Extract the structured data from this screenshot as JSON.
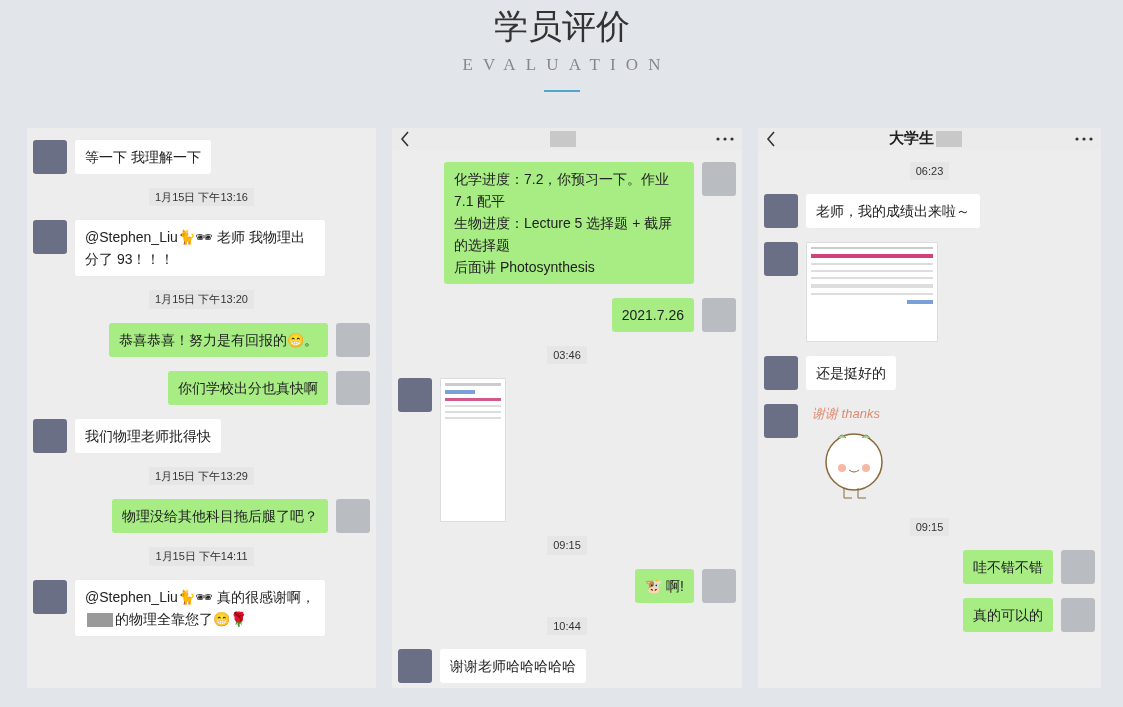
{
  "heading": {
    "title": "学员评价",
    "subtitle": "EVALUATION"
  },
  "panels": [
    {
      "header": false,
      "messages": [
        {
          "kind": "text",
          "outgoing": false,
          "lines": [
            [
              "等一下 我理解一下"
            ]
          ]
        },
        {
          "kind": "time",
          "text": "1月15日 下午13:16"
        },
        {
          "kind": "text",
          "outgoing": false,
          "lines": [
            [
              "@Stephen_Liu🐈🕶 老师 我物理出分了 93！！！"
            ]
          ]
        },
        {
          "kind": "time",
          "text": "1月15日 下午13:20"
        },
        {
          "kind": "text",
          "outgoing": true,
          "lines": [
            [
              "恭喜恭喜！努力是有回报的😁。"
            ]
          ]
        },
        {
          "kind": "text",
          "outgoing": true,
          "lines": [
            [
              "你们学校出分也真快啊"
            ]
          ]
        },
        {
          "kind": "text",
          "outgoing": false,
          "lines": [
            [
              "我们物理老师批得快"
            ]
          ]
        },
        {
          "kind": "time",
          "text": "1月15日 下午13:29"
        },
        {
          "kind": "text",
          "outgoing": true,
          "lines": [
            [
              "物理没给其他科目拖后腿了吧？"
            ]
          ]
        },
        {
          "kind": "time",
          "text": "1月15日 下午14:11"
        },
        {
          "kind": "text",
          "outgoing": false,
          "lines": [
            [
              "@Stephen_Liu🐈🕶 真的很感谢啊，",
              "的物理全靠您了😁🌹"
            ]
          ]
        }
      ]
    },
    {
      "header": true,
      "messages": [
        {
          "kind": "text",
          "outgoing": true,
          "lines": [
            [
              "化学进度：7.2，你预习一下。作业 7.1 配平"
            ],
            [
              "生物进度：Lecture 5 选择题 + 截屏的选择题"
            ],
            [
              "后面讲 Photosynthesis"
            ]
          ]
        },
        {
          "kind": "text",
          "outgoing": true,
          "lines": [
            [
              "2021.7.26"
            ]
          ]
        },
        {
          "kind": "time",
          "text": "03:46"
        },
        {
          "kind": "phone_screenshot",
          "outgoing": false
        },
        {
          "kind": "time",
          "text": "09:15"
        },
        {
          "kind": "text",
          "outgoing": true,
          "lines": [
            [
              "🐮 啊!"
            ]
          ]
        },
        {
          "kind": "time",
          "text": "10:44"
        },
        {
          "kind": "text",
          "outgoing": false,
          "lines": [
            [
              "谢谢老师哈哈哈哈哈"
            ]
          ]
        }
      ]
    },
    {
      "header": true,
      "title": "大学生",
      "messages": [
        {
          "kind": "time",
          "text": "06:23"
        },
        {
          "kind": "text",
          "outgoing": false,
          "lines": [
            [
              "老师，我的成绩出来啦～"
            ]
          ]
        },
        {
          "kind": "results_screenshot",
          "outgoing": false
        },
        {
          "kind": "text",
          "outgoing": false,
          "lines": [
            [
              "还是挺好的"
            ]
          ]
        },
        {
          "kind": "sticker",
          "outgoing": false,
          "text": "谢谢 thanks"
        },
        {
          "kind": "time",
          "text": "09:15"
        },
        {
          "kind": "text",
          "outgoing": true,
          "lines": [
            [
              "哇不错不错"
            ]
          ]
        },
        {
          "kind": "text",
          "outgoing": true,
          "lines": [
            [
              "真的可以的"
            ]
          ]
        }
      ]
    }
  ]
}
